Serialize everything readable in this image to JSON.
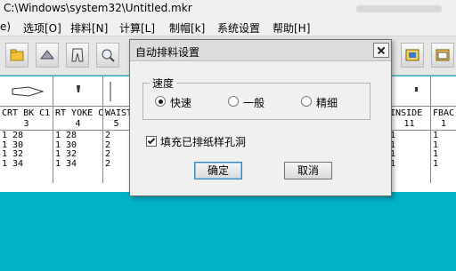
{
  "window": {
    "title": "C:\\Windows\\system32\\Untitled.mkr"
  },
  "menu": [
    {
      "label": "e)"
    },
    {
      "label": "选项[O]"
    },
    {
      "label": "排料[N]"
    },
    {
      "label": "计算[L]"
    },
    {
      "label": "制帽[k]"
    },
    {
      "label": "系统设置"
    },
    {
      "label": "帮助[H]"
    }
  ],
  "toolbar": {
    "buttons": [
      {
        "icon": "open-folder-icon"
      },
      {
        "icon": "layout-icon"
      },
      {
        "icon": "pants-icon"
      },
      {
        "icon": "zoom-icon"
      },
      {
        "icon": "palette-icon"
      },
      {
        "icon": "flag-icon"
      },
      {
        "icon": "tool-icon"
      },
      {
        "icon": "color-wheel-icon"
      },
      {
        "icon": "marker-icon"
      },
      {
        "icon": "window-icon"
      }
    ]
  },
  "marker_table": {
    "columns": [
      {
        "name": "CRT BK C1",
        "number": "3",
        "rows": [
          "1 28",
          "1 30",
          "1 32",
          "1 34"
        ]
      },
      {
        "name": "RT YOKE C",
        "number": "4",
        "rows": [
          "1 28",
          "1 30",
          "1 32",
          "1 34"
        ]
      },
      {
        "name": "WAIST",
        "number": "5",
        "rows": [
          "2",
          "2",
          "2",
          "2"
        ]
      },
      {
        "name": "INSIDE",
        "number": "11",
        "rows": [
          "1",
          "1",
          "1",
          "1"
        ]
      },
      {
        "name": "FBAC",
        "number": "1",
        "rows": [
          "1",
          "1",
          "1",
          "1"
        ]
      }
    ]
  },
  "dialog": {
    "title": "自动排料设置",
    "speed_group_label": "速度",
    "options": [
      {
        "label": "快速",
        "checked": true
      },
      {
        "label": "一般",
        "checked": false
      },
      {
        "label": "精细",
        "checked": false
      }
    ],
    "fill_holes_label": "填充已排纸样孔洞",
    "fill_holes_checked": true,
    "ok_label": "确定",
    "cancel_label": "取消"
  }
}
